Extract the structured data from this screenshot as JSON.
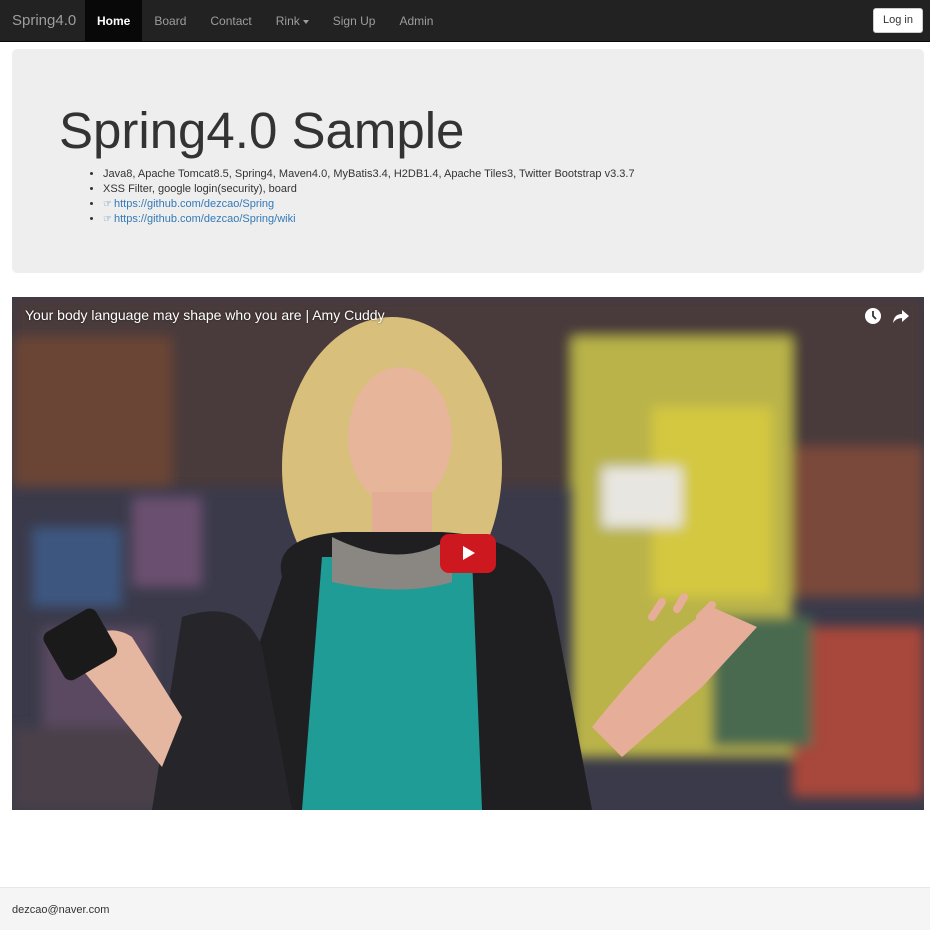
{
  "navbar": {
    "brand": "Spring4.0",
    "items": [
      {
        "label": "Home",
        "active": true
      },
      {
        "label": "Board"
      },
      {
        "label": "Contact"
      },
      {
        "label": "Rink",
        "dropdown": true
      },
      {
        "label": "Sign Up"
      },
      {
        "label": "Admin"
      }
    ],
    "login_label": "Log in"
  },
  "jumbotron": {
    "title": "Spring4.0 Sample",
    "bullets": [
      "Java8, Apache Tomcat8.5, Spring4, Maven4.0, MyBatis3.4, H2DB1.4, Apache Tiles3, Twitter Bootstrap v3.3.7",
      "XSS Filter, google login(security), board"
    ],
    "links": [
      {
        "icon": "hand-right-icon",
        "text": "https://github.com/dezcao/Spring"
      },
      {
        "icon": "hand-right-icon",
        "text": "https://github.com/dezcao/Spring/wiki"
      }
    ]
  },
  "video": {
    "title": "Your body language may shape who you are | Amy Cuddy",
    "icons": [
      "watch-later-icon",
      "share-icon",
      "play-icon"
    ],
    "colors": {
      "play_button": "#cc181e"
    }
  },
  "footer": {
    "text": "dezcao@naver.com"
  }
}
